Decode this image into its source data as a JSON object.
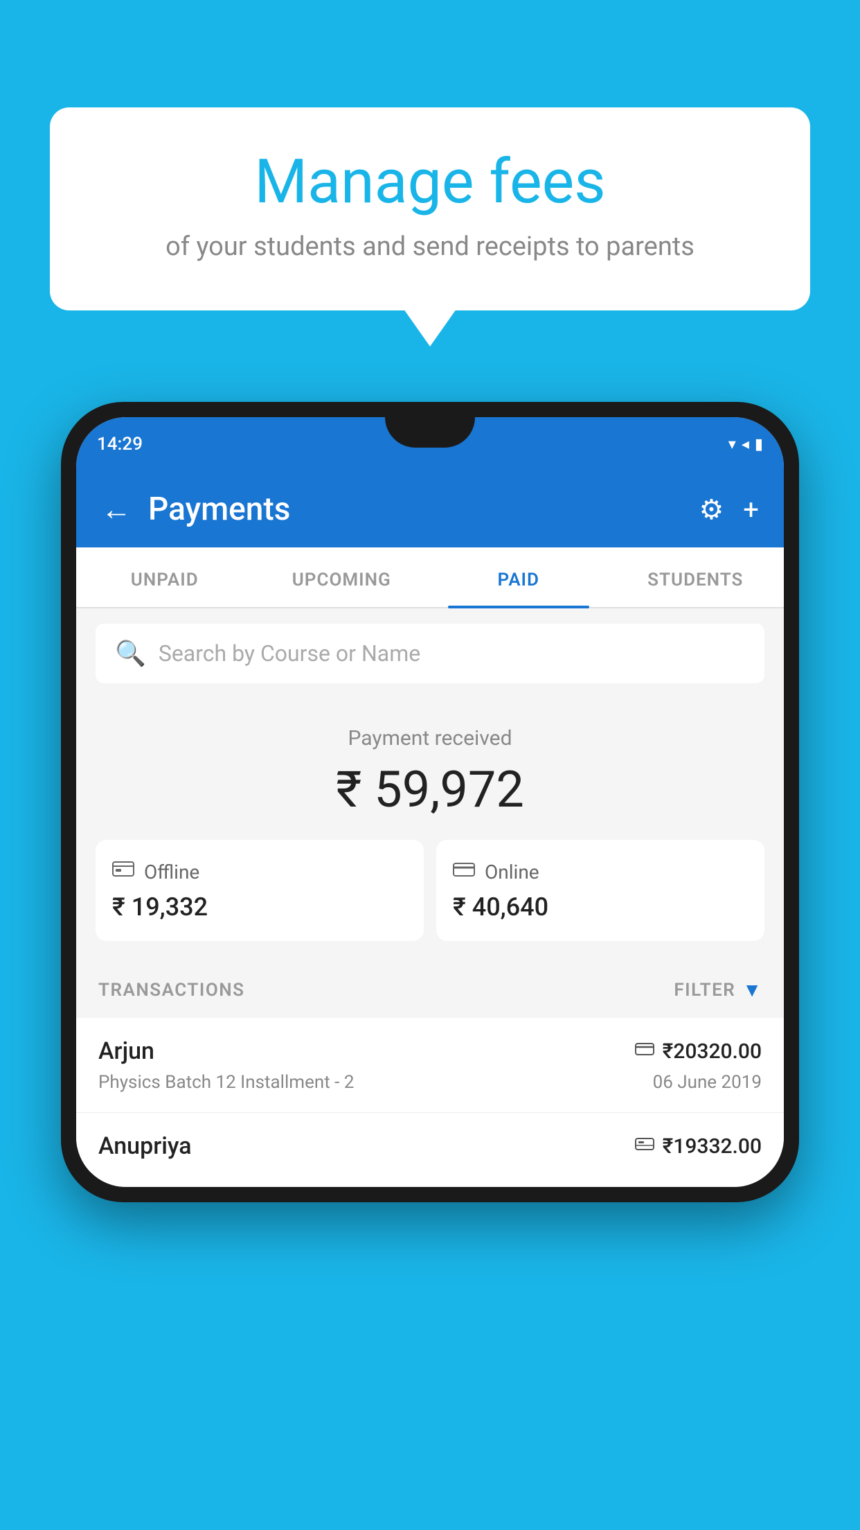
{
  "background_color": "#1ab5e8",
  "speech_bubble": {
    "title": "Manage fees",
    "subtitle": "of your students and send receipts to parents"
  },
  "phone": {
    "status_bar": {
      "time": "14:29"
    },
    "app_bar": {
      "title": "Payments",
      "back_label": "←",
      "settings_label": "⚙",
      "add_label": "+"
    },
    "tabs": [
      {
        "label": "UNPAID",
        "active": false
      },
      {
        "label": "UPCOMING",
        "active": false
      },
      {
        "label": "PAID",
        "active": true
      },
      {
        "label": "STUDENTS",
        "active": false
      }
    ],
    "search": {
      "placeholder": "Search by Course or Name"
    },
    "payment_summary": {
      "label": "Payment received",
      "total": "₹ 59,972",
      "offline": {
        "label": "Offline",
        "amount": "₹ 19,332",
        "icon": "💳"
      },
      "online": {
        "label": "Online",
        "amount": "₹ 40,640",
        "icon": "💳"
      }
    },
    "transactions_section": {
      "header_label": "TRANSACTIONS",
      "filter_label": "FILTER"
    },
    "transactions": [
      {
        "name": "Arjun",
        "course": "Physics Batch 12 Installment - 2",
        "amount": "₹20320.00",
        "date": "06 June 2019",
        "payment_icon": "💳"
      },
      {
        "name": "Anupriya",
        "course": "",
        "amount": "₹19332.00",
        "date": "",
        "payment_icon": "💴"
      }
    ]
  }
}
